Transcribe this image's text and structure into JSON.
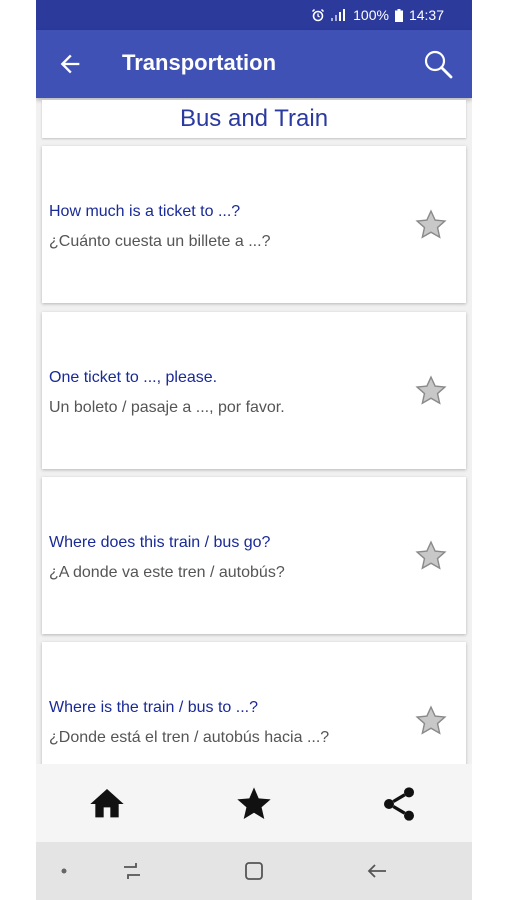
{
  "status": {
    "battery": "100%",
    "time": "14:37"
  },
  "appbar": {
    "title": "Transportation",
    "back_icon": "arrow-back-icon",
    "search_icon": "search-icon"
  },
  "section": {
    "title": "Bus and Train"
  },
  "phrases": [
    {
      "english": "How much is a ticket to ...?",
      "spanish": "¿Cuánto cuesta un billete a ...?"
    },
    {
      "english": "One ticket to ..., please.",
      "spanish": "Un boleto / pasaje a ..., por favor."
    },
    {
      "english": "Where does this train / bus go?",
      "spanish": "¿A donde va este tren / autobús?"
    },
    {
      "english": "Where is the train / bus to ...?",
      "spanish": "¿Donde está el tren / autobús hacia ...?"
    }
  ],
  "bottom_nav": [
    "home-icon",
    "star-icon",
    "share-icon"
  ],
  "colors": {
    "appbar": "#3f51b5",
    "statusbar": "#2c3a9c",
    "english_text": "#1a2a96",
    "spanish_text": "#555555"
  }
}
